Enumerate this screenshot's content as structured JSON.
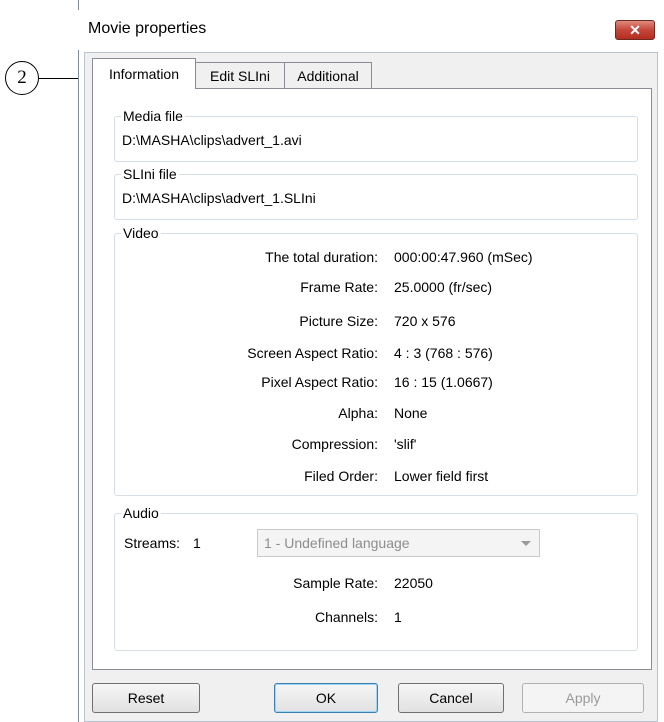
{
  "callout": {
    "number": "2"
  },
  "window": {
    "title": "Movie properties",
    "close_glyph": "✕"
  },
  "tabs": [
    {
      "label": "Information",
      "active": true
    },
    {
      "label": "Edit SLIni",
      "active": false
    },
    {
      "label": "Additional",
      "active": false
    }
  ],
  "media_file": {
    "legend": "Media file",
    "value": "D:\\MASHA\\clips\\advert_1.avi"
  },
  "slini_file": {
    "legend": "SLIni file",
    "value": "D:\\MASHA\\clips\\advert_1.SLIni"
  },
  "video": {
    "legend": "Video",
    "rows": [
      {
        "label": "The total duration:",
        "value": "000:00:47.960 (mSec)"
      },
      {
        "label": "Frame Rate:",
        "value": "25.0000 (fr/sec)"
      },
      {
        "label": "Picture Size:",
        "value": "720 x 576"
      },
      {
        "label": "Screen Aspect Ratio:",
        "value": "4 : 3 (768 : 576)"
      },
      {
        "label": "Pixel Aspect Ratio:",
        "value": "16 : 15 (1.0667)"
      },
      {
        "label": "Alpha:",
        "value": "None"
      },
      {
        "label": "Compression:",
        "value": "'slif'"
      },
      {
        "label": "Filed Order:",
        "value": "Lower field first"
      }
    ]
  },
  "audio": {
    "legend": "Audio",
    "streams_label": "Streams:",
    "streams_value": "1",
    "stream_select": "1 - Undefined language",
    "rows": [
      {
        "label": "Sample Rate:",
        "value": "22050"
      },
      {
        "label": "Channels:",
        "value": "1"
      }
    ]
  },
  "buttons": {
    "reset": "Reset",
    "ok": "OK",
    "cancel": "Cancel",
    "apply": "Apply"
  }
}
